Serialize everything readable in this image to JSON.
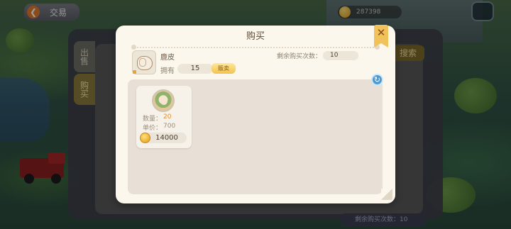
{
  "background": {
    "trade_button_label": "交易",
    "coin_balance": "287398",
    "tabs": [
      {
        "label": "出售"
      },
      {
        "label": "购买"
      }
    ],
    "search_label": "搜索",
    "remaining_bottom": "剩余购买次数：10"
  },
  "dialog": {
    "title": "购买",
    "close_icon": "close-icon",
    "item": {
      "name": "鹿皮",
      "icon": "deer-hide-icon",
      "own_label": "拥有",
      "own_count": "15",
      "sell_button_label": "贩卖"
    },
    "remaining_label": "剩余购买次数：",
    "remaining_count": "10",
    "refresh_icon": "refresh-icon",
    "listings": [
      {
        "seller_avatar": "seller-avatar",
        "quantity_label": "数量：",
        "quantity": "20",
        "unit_price_label": "单价：",
        "unit_price": "700",
        "total": "14000"
      }
    ]
  },
  "colors": {
    "accent_gold": "#f2c25a",
    "dialog_bg": "#fbf7ec",
    "list_bg": "#e8e0d6",
    "quantity_orange": "#e08a2a",
    "refresh_blue": "#4b9ad6"
  }
}
